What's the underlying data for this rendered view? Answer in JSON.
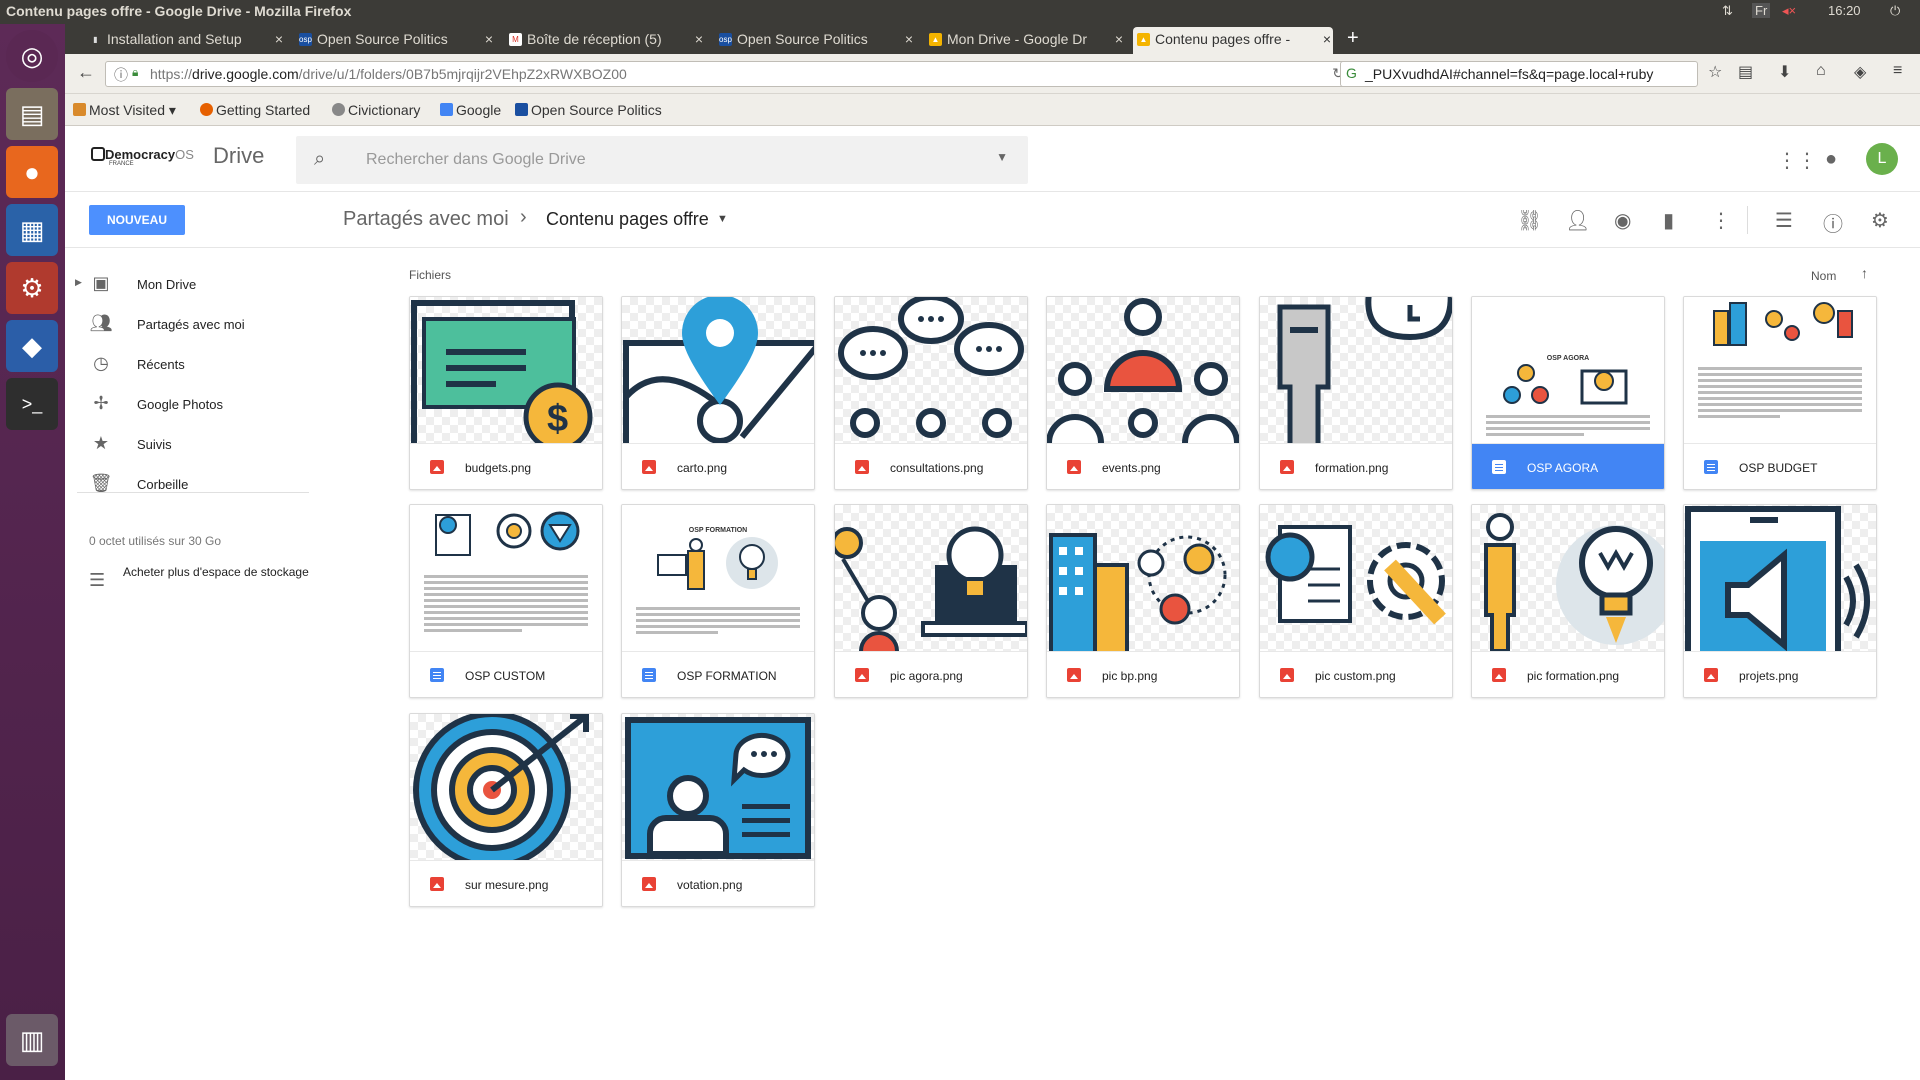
{
  "window": {
    "title": "Contenu pages offre - Google Drive - Mozilla Firefox",
    "time": "16:20",
    "keyboard": "Fr"
  },
  "tabs": [
    {
      "label": "Installation and Setup",
      "favicon_color": "#3c3b37"
    },
    {
      "label": "Open Source Politics",
      "favicon_color": "#1a73e8"
    },
    {
      "label": "Boîte de réception (5)",
      "favicon_color": "#d93025"
    },
    {
      "label": "Open Source Politics",
      "favicon_color": "#1a73e8"
    },
    {
      "label": "Mon Drive - Google Dr",
      "favicon_color": "#34a853"
    },
    {
      "label": "Contenu pages offre -",
      "favicon_color": "#34a853"
    }
  ],
  "nav": {
    "url_prefix": "https://",
    "url_host": "drive.google.com",
    "url_path": "/drive/u/1/folders/0B7b5mjrqijr2VEhpZ2xRWXBOZ00",
    "search_text": "_PUXvudhdAI#channel=fs&q=page.local+ruby"
  },
  "bookmarks": [
    "Most Visited",
    "Getting Started",
    "Civictionary",
    "Google",
    "Open Source Politics"
  ],
  "drive": {
    "logo_text": "Democracy",
    "logo_os": "OS",
    "logo_sub": "FRANCE",
    "app_name": "Drive",
    "search_placeholder": "Rechercher dans Google Drive",
    "avatar_letter": "L",
    "new_button": "NOUVEAU",
    "breadcrumb_parent": "Partagés avec moi",
    "breadcrumb_current": "Contenu pages offre",
    "section_label": "Fichiers",
    "sort_label": "Nom"
  },
  "sidebar": {
    "items": [
      {
        "label": "Mon Drive",
        "icon": "drive-icon"
      },
      {
        "label": "Partagés avec moi",
        "icon": "people-icon"
      },
      {
        "label": "Récents",
        "icon": "clock-icon"
      },
      {
        "label": "Google Photos",
        "icon": "photos-icon"
      },
      {
        "label": "Suivis",
        "icon": "star-icon"
      },
      {
        "label": "Corbeille",
        "icon": "trash-icon"
      }
    ],
    "storage": "0 octet utilisés sur 30 Go",
    "buy_storage": "Acheter plus d'espace de stockage"
  },
  "files": [
    {
      "name": "budgets.png",
      "type": "image",
      "icon": "budget-dollar-icon",
      "selected": false
    },
    {
      "name": "carto.png",
      "type": "image",
      "icon": "map-pin-icon",
      "selected": false
    },
    {
      "name": "consultations.png",
      "type": "image",
      "icon": "chat-bubbles-icon",
      "selected": false
    },
    {
      "name": "events.png",
      "type": "image",
      "icon": "audience-icon",
      "selected": false
    },
    {
      "name": "formation.png",
      "type": "image",
      "icon": "trainer-icon",
      "selected": false
    },
    {
      "name": "OSP AGORA",
      "type": "doc",
      "icon": "doc-agora-icon",
      "selected": true,
      "doc_title": "OSP AGORA"
    },
    {
      "name": "OSP BUDGET",
      "type": "doc",
      "icon": "doc-budget-icon",
      "selected": false
    },
    {
      "name": "OSP CUSTOM",
      "type": "doc",
      "icon": "doc-custom-icon",
      "selected": false
    },
    {
      "name": "OSP FORMATION",
      "type": "doc",
      "icon": "doc-formation-icon",
      "selected": false,
      "doc_title": "OSP FORMATION"
    },
    {
      "name": "pic agora.png",
      "type": "image",
      "icon": "agora-lightbulb-icon",
      "selected": false
    },
    {
      "name": "pic bp.png",
      "type": "image",
      "icon": "city-people-icon",
      "selected": false
    },
    {
      "name": "pic custom.png",
      "type": "image",
      "icon": "magnifier-gear-icon",
      "selected": false
    },
    {
      "name": "pic formation.png",
      "type": "image",
      "icon": "lightbulb-rocket-icon",
      "selected": false
    },
    {
      "name": "projets.png",
      "type": "image",
      "icon": "megaphone-icon",
      "selected": false
    },
    {
      "name": "sur mesure.png",
      "type": "image",
      "icon": "target-icon",
      "selected": false
    },
    {
      "name": "votation.png",
      "type": "image",
      "icon": "vote-card-icon",
      "selected": false
    }
  ],
  "colors": {
    "accent": "#4285f4",
    "new_button": "#4d90fe",
    "navy": "#1f3347",
    "teal": "#4dbf9c",
    "orange": "#f5b73b",
    "red": "#e9543f",
    "sky": "#2d9fd9"
  }
}
